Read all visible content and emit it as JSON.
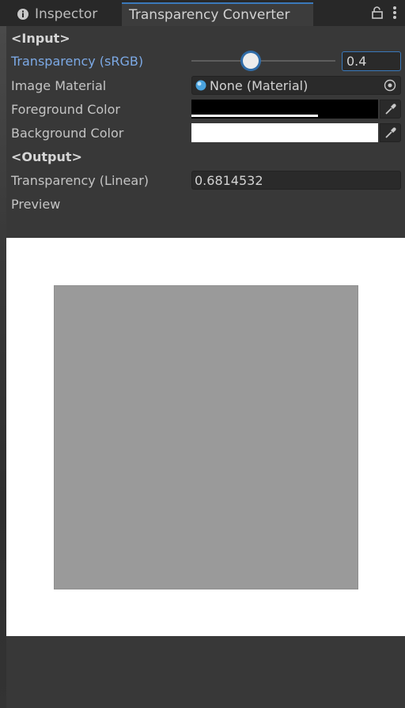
{
  "tabs": {
    "inspector_label": "Inspector",
    "active_label": "Transparency Converter"
  },
  "input_section": {
    "header": "<Input>",
    "transparency_label": "Transparency (sRGB)",
    "transparency_value": "0.4",
    "transparency_fraction": 0.4,
    "image_material_label": "Image Material",
    "image_material_value": "None (Material)",
    "foreground_label": "Foreground Color",
    "foreground_color": "#000000",
    "background_label": "Background Color",
    "background_color": "#ffffff"
  },
  "output_section": {
    "header": "<Output>",
    "transparency_linear_label": "Transparency (Linear)",
    "transparency_linear_value": "0.6814532",
    "preview_label": "Preview",
    "preview_square_color": "#9a9a9a"
  },
  "colors": {
    "accent": "#3a79bb",
    "active_label": "#7ca9e5"
  },
  "icons": {
    "info": "info-icon",
    "lock": "lock-icon",
    "menu": "more-vertical-icon",
    "object_picker": "target-icon",
    "eyedropper": "eyedropper-icon"
  }
}
